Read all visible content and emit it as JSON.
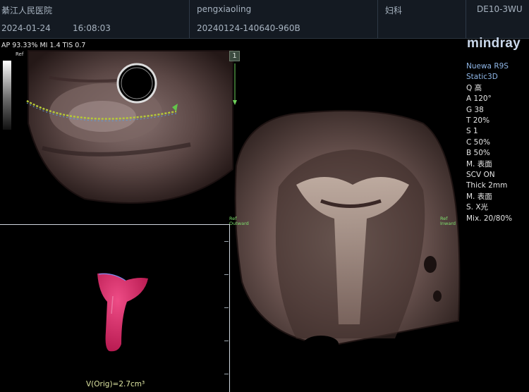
{
  "header": {
    "hospital": "綦江人民医院",
    "date": "2024-01-24",
    "time": "16:08:03",
    "operator": "pengxiaoling",
    "exam_id": "20240124-140640-960B",
    "department": "妇科",
    "probe": "DE10-3WU"
  },
  "scan_info": "AP 93.33%  MI 1.4  TIS 0.7",
  "ref_label": "Ref",
  "brand": "mindray",
  "params": [
    "Nuewa R9S",
    "Static3D",
    "Q 高",
    "A 120°",
    "G 38",
    "T 20%",
    "S 1",
    "C 50%",
    "B 50%",
    "M. 表面",
    "SCV ON",
    "Thick 2mm",
    "M. 表面",
    "S. X光",
    "Mix. 20/80%"
  ],
  "page_marker": "1",
  "orientation": {
    "left_ref": "Ref",
    "left_dir": "Outward",
    "right_ref": "Ref",
    "right_dir": "Inward"
  },
  "volume": "V(Orig)=2.7cm³",
  "colors": {
    "render": "#d0225e",
    "brand": "#c9d7ea",
    "annotation": "#7ee06e"
  }
}
